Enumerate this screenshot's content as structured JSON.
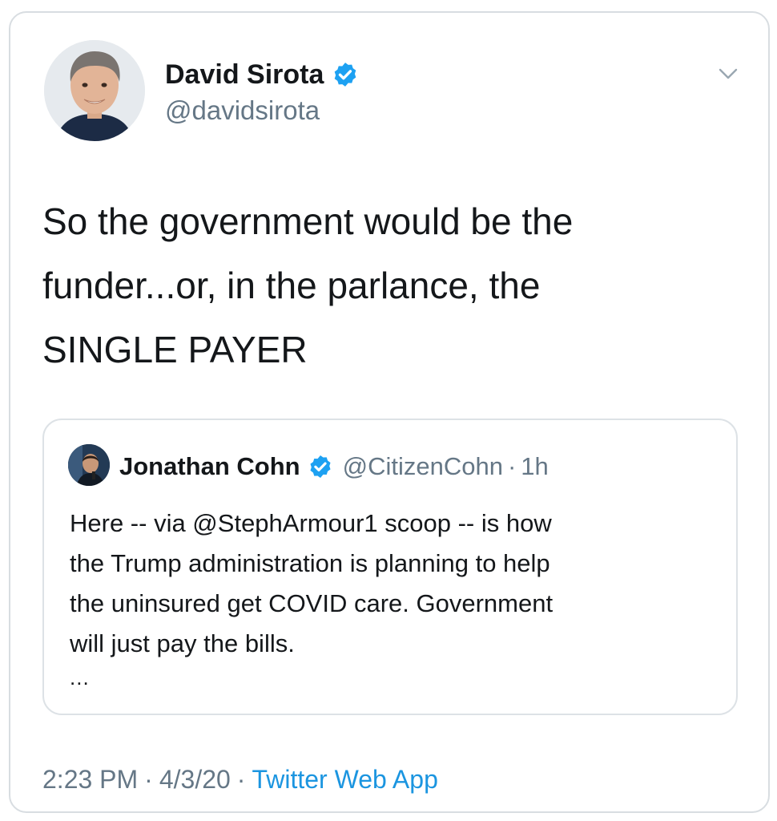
{
  "tweet": {
    "author": {
      "display_name": "David Sirota",
      "handle": "@davidsirota",
      "verified": true,
      "avatar_icon": "author-avatar"
    },
    "menu_icon": "chevron-down-icon",
    "text_lines": [
      "So the government would be the",
      "funder...or, in the parlance, the",
      "SINGLE PAYER"
    ],
    "quoted_tweet": {
      "author": {
        "display_name": "Jonathan Cohn",
        "handle": "@CitizenCohn",
        "verified": true
      },
      "separator": "·",
      "time": "1h",
      "text_lines": [
        "Here -- via @StephArmour1 scoop -- is how",
        "the Trump administration is planning to help",
        "the uninsured get COVID care. Government",
        "will just pay the bills."
      ],
      "truncation": "..."
    },
    "footer": {
      "time": "2:23 PM",
      "separator": "·",
      "date": "4/3/20",
      "source": "Twitter Web App"
    }
  },
  "colors": {
    "text_primary": "#14171a",
    "text_secondary": "#657786",
    "link_blue": "#1b95e0",
    "verified_blue": "#1da1f2",
    "border": "#d8dde1"
  }
}
